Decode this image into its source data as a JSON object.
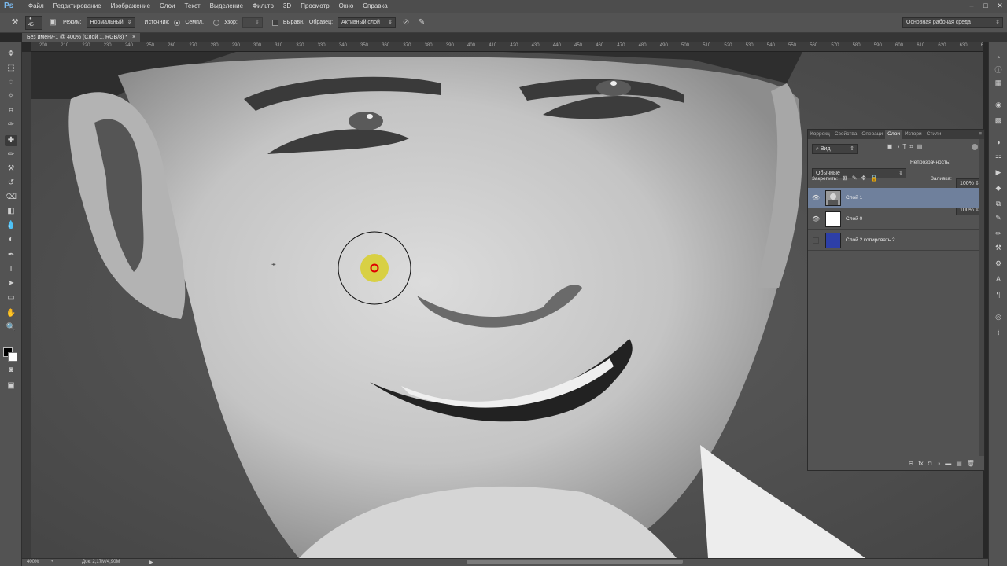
{
  "app": {
    "logo": "Ps"
  },
  "menu": [
    "Файл",
    "Редактирование",
    "Изображение",
    "Слои",
    "Текст",
    "Выделение",
    "Фильтр",
    "3D",
    "Просмотр",
    "Окно",
    "Справка"
  ],
  "window_controls": {
    "minimize": "–",
    "maximize": "□",
    "close": "✕"
  },
  "options": {
    "brush_size": "45",
    "mode_label": "Режим:",
    "mode_value": "Нормальный",
    "source_label": "Источник:",
    "sampled_label": "Семпл.",
    "pattern_label": "Узор:",
    "aligned_label": "Выравн.",
    "sample_label": "Образец:",
    "sample_value": "Активный слой",
    "workspace": "Основная рабочая среда"
  },
  "document": {
    "tab_title": "Без имени-1 @ 400% (Слой 1, RGB/8) *",
    "close": "×"
  },
  "ruler_ticks": [
    "200",
    "210",
    "220",
    "230",
    "240",
    "250",
    "260",
    "270",
    "280",
    "290",
    "300",
    "310",
    "320",
    "330",
    "340",
    "350",
    "360",
    "370",
    "380",
    "390",
    "400",
    "410",
    "420",
    "430",
    "440",
    "450",
    "460",
    "470",
    "480",
    "490",
    "500",
    "510",
    "520",
    "530",
    "540",
    "550",
    "560",
    "570",
    "580",
    "590",
    "600",
    "610",
    "620",
    "630",
    "640"
  ],
  "status": {
    "zoom": "400%",
    "doc_size": "Док: 2,17M/4,90M"
  },
  "layers_panel": {
    "tabs": [
      "Коррекц",
      "Свойства",
      "Операци",
      "Слои",
      "Истори",
      "Стили"
    ],
    "active_tab": "Слои",
    "menu": "≡",
    "filter_kind": "Вид",
    "blend_mode": "Обычные",
    "opacity_label": "Непрозрачность:",
    "opacity_value": "100%",
    "lock_label": "Закрепить:",
    "fill_label": "Заливка:",
    "fill_value": "100%",
    "layers": [
      {
        "name": "Слой 1",
        "selected": true,
        "visible": true,
        "thumb": "photo"
      },
      {
        "name": "Слой 0",
        "selected": false,
        "visible": true,
        "thumb": "#ffffff"
      },
      {
        "name": "Слой 2 копировать 2",
        "selected": false,
        "visible": false,
        "thumb": "#2d3fa8"
      }
    ]
  },
  "colors": {
    "accent_brush": "#d8cf2a",
    "cursor_ring": "#e00000",
    "layer_selected": "#6f809c"
  }
}
